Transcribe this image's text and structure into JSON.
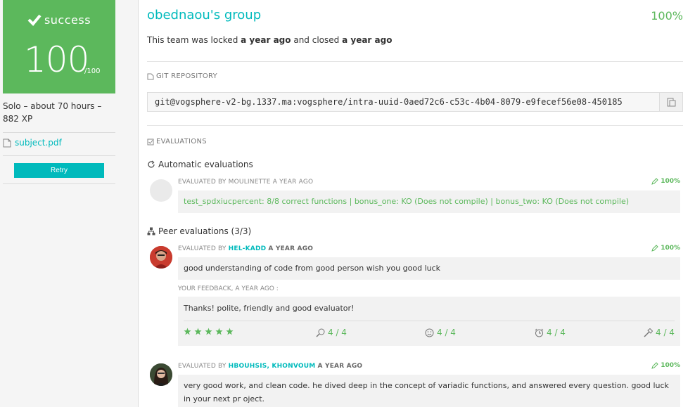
{
  "status": {
    "label": "success",
    "score": "100",
    "max": "/100",
    "color": "#5cb85c"
  },
  "sidebar": {
    "meta": "Solo – about 70 hours – 882 XP",
    "subject_link": "subject.pdf",
    "retry_label": "Retry"
  },
  "group": {
    "title": "obednaou's group",
    "percent": "100%",
    "locked_prefix": "This team was locked",
    "locked_time": "a year ago",
    "closed_prefix": "and closed",
    "closed_time": "a year ago"
  },
  "repository": {
    "heading": "GIT REPOSITORY",
    "url": "git@vogsphere-v2-bg.1337.ma:vogsphere/intra-uuid-0aed72c6-c53c-4b04-8079-e9fecef56e08-450185"
  },
  "evaluations": {
    "heading": "EVALUATIONS",
    "automatic": {
      "heading": "Automatic evaluations",
      "prefix": "EVALUATED BY MOULINETTE",
      "when": "A YEAR AGO",
      "percent": "100%",
      "result": "test_spdxiucpercent: 8/8 correct functions | bonus_one: KO (Does not compile) | bonus_two: KO (Does not compile)"
    },
    "peer": {
      "heading": "Peer evaluations (3/3)",
      "items": [
        {
          "prefix": "EVALUATED BY",
          "evaluator": "HEL-KADD",
          "when": "A YEAR AGO",
          "percent": "100%",
          "comment": "good understanding of code from good person wish you good luck",
          "feedback_heading": "YOUR FEEDBACK, A YEAR AGO :",
          "feedback": "Thanks! polite, friendly and good evaluator!",
          "stars": 5,
          "ratings": [
            "4 / 4",
            "4 / 4",
            "4 / 4",
            "4 / 4"
          ]
        },
        {
          "prefix": "EVALUATED BY",
          "evaluator": "HBOUHSIS, KHONVOUM",
          "when": "A YEAR AGO",
          "percent": "100%",
          "comment": "very good work, and clean code. he dived deep in the concept of variadic functions, and answered every question. good luck in your next pr oject."
        }
      ]
    }
  },
  "colors": {
    "accent": "#00babc",
    "success": "#5cb85c"
  },
  "icons": {
    "check": "check-icon",
    "file": "file-icon",
    "repo": "git-file-icon",
    "copy": "clipboard-icon",
    "evaluations": "checklist-icon",
    "auto": "refresh-icon",
    "peer": "sitemap-icon",
    "pct": "pencil-check-icon",
    "star": "star-icon",
    "nice": "magnifier-icon",
    "friendly": "smile-icon",
    "punctual": "alarm-clock-icon",
    "interested": "hammer-icon"
  }
}
